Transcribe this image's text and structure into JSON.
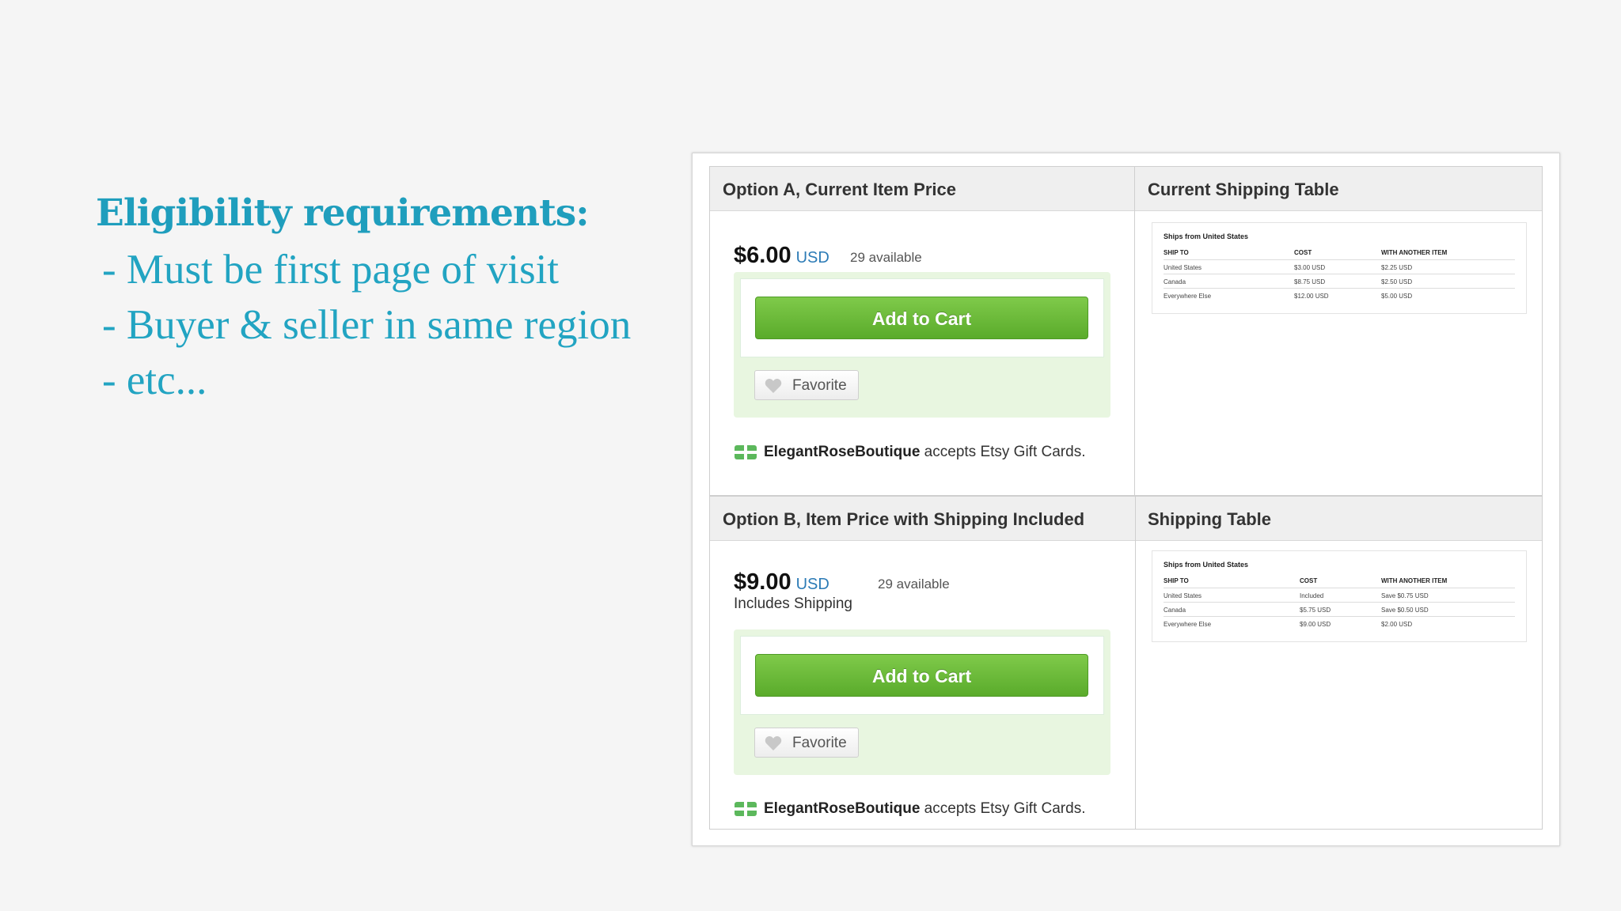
{
  "slide": {
    "heading": "Eligibility requirements:",
    "bullets": [
      "- Must be first page of visit",
      "- Buyer & seller in same region",
      "- etc..."
    ]
  },
  "option_a": {
    "left_title": "Option A, Current Item Price",
    "right_title": "Current Shipping Table",
    "price": "$6.00",
    "currency": "USD",
    "available": "29 available",
    "add_to_cart": "Add to Cart",
    "favorite": "Favorite",
    "shop_name": "ElegantRoseBoutique",
    "gift_text": " accepts Etsy Gift Cards.",
    "shipping": {
      "title": "Ships from United States",
      "headers": [
        "SHIP TO",
        "COST",
        "WITH ANOTHER ITEM"
      ],
      "rows": [
        [
          "United States",
          "$3.00 USD",
          "$2.25 USD"
        ],
        [
          "Canada",
          "$8.75 USD",
          "$2.50 USD"
        ],
        [
          "Everywhere Else",
          "$12.00 USD",
          "$5.00 USD"
        ]
      ]
    }
  },
  "option_b": {
    "left_title": "Option B, Item Price with Shipping Included",
    "right_title": "Shipping Table",
    "price": "$9.00",
    "currency": "USD",
    "available": "29 available",
    "includes": "Includes Shipping",
    "add_to_cart": "Add to Cart",
    "favorite": "Favorite",
    "shop_name": "ElegantRoseBoutique",
    "gift_text": " accepts Etsy Gift Cards.",
    "shipping": {
      "title": "Ships from United States",
      "headers": [
        "SHIP TO",
        "COST",
        "WITH ANOTHER ITEM"
      ],
      "rows": [
        [
          "United States",
          "Included",
          "Save $0.75 USD"
        ],
        [
          "Canada",
          "$5.75 USD",
          "Save $0.50 USD"
        ],
        [
          "Everywhere Else",
          "$9.00 USD",
          "$2.00 USD"
        ]
      ]
    }
  },
  "icons": {
    "favorite": "heart-icon",
    "gift": "gift-card-icon"
  },
  "colors": {
    "heading": "#1f9ebd",
    "cart_button": "#5aab2b",
    "buy_area": "#e8f6e0",
    "currency": "#2c7bb6"
  }
}
